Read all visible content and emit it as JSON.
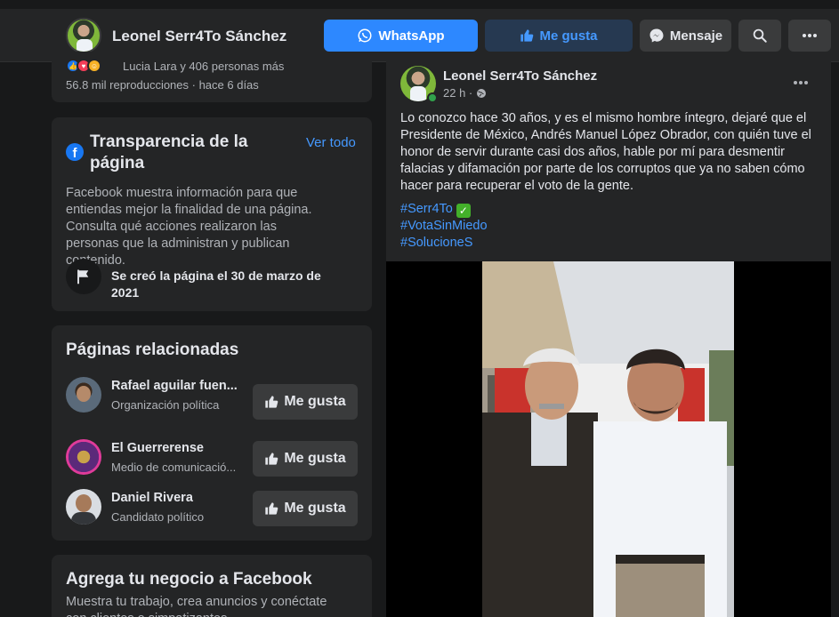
{
  "header": {
    "page_name": "Leonel Serr4To Sánchez",
    "whatsapp_label": "WhatsApp",
    "like_label": "Me gusta",
    "message_label": "Mensaje"
  },
  "prev_post": {
    "reactions_text": "Lucia Lara y 406 personas más",
    "views_text": "56.8 mil reproducciones · hace 6 días"
  },
  "transparency": {
    "title": "Transparencia de la página",
    "see_all": "Ver todo",
    "body": "Facebook muestra información para que entiendas mejor la finalidad de una página. Consulta qué acciones realizaron las personas que la administran y publican contenido.",
    "created": "Se creó la página el 30 de marzo de 2021"
  },
  "related": {
    "title": "Páginas relacionadas",
    "like_label": "Me gusta",
    "items": [
      {
        "name": "Rafael aguilar fuen...",
        "sub": "Organización política",
        "extra": ".."
      },
      {
        "name": "El Guerrerense",
        "sub": "Medio de comunicació..."
      },
      {
        "name": "Daniel Rivera",
        "sub": "Candidato político"
      }
    ]
  },
  "business": {
    "title": "Agrega tu negocio a Facebook",
    "body": "Muestra tu trabajo, crea anuncios y conéctate con clientes o simpatizantes."
  },
  "post": {
    "author": "Leonel Serr4To Sánchez",
    "time": "22 h ·",
    "text": "Lo conozco hace 30 años, y es el mismo hombre íntegro, dejaré que el Presidente de México, Andrés Manuel López Obrador, con quién tuve el honor de servir durante casi dos años, hable por mí para desmentir falacias y difamación por parte de los corruptos que ya no saben cómo hacer para recuperar el voto de la gente.",
    "hashtags": [
      "#Serr4To",
      "#VotaSinMiedo",
      "#SolucioneS"
    ],
    "check_mark": "✓"
  },
  "colors": {
    "accent": "#2d88ff",
    "link": "#4599ff",
    "card": "#242526",
    "background": "#18191a"
  }
}
